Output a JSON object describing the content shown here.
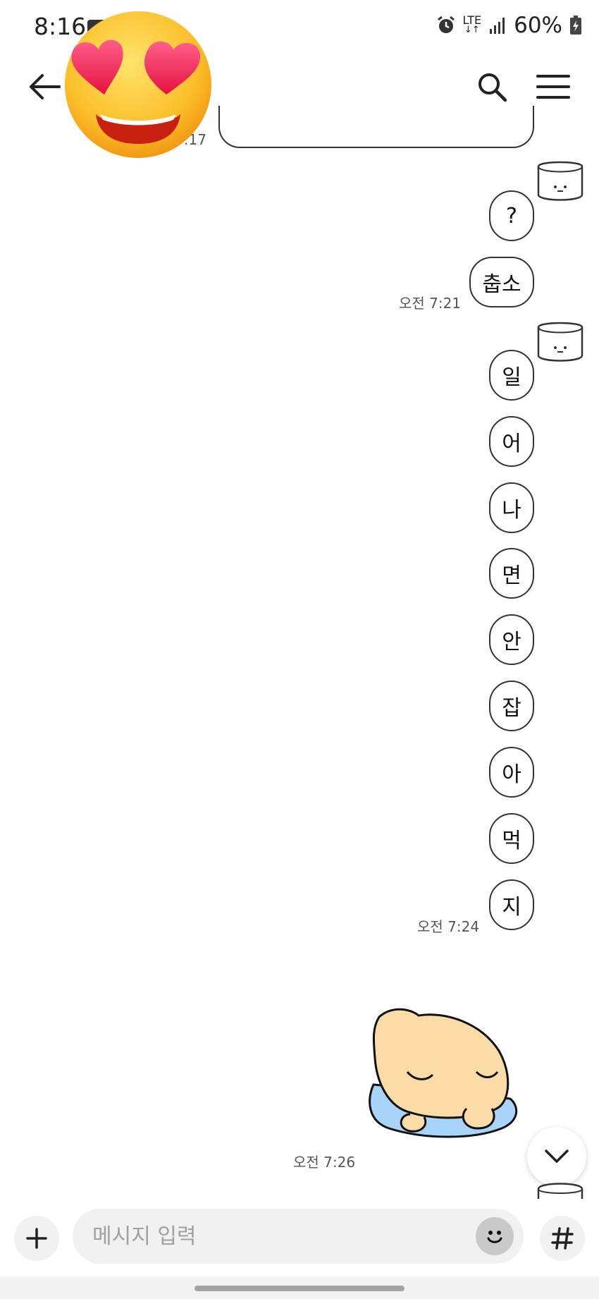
{
  "status_bar": {
    "time": "8:16",
    "network": "LTE",
    "battery": "60%"
  },
  "header": {
    "back_icon": "arrow-left-icon",
    "search_icon": "search-icon",
    "menu_icon": "hamburger-menu-icon"
  },
  "messages": {
    "top_partial_time": "7:17",
    "question": "?",
    "chulso": "춥소",
    "time_1": "오전 7:21",
    "chars": [
      "일",
      "어",
      "나",
      "면",
      "안",
      "잡",
      "아",
      "먹",
      "지"
    ],
    "time_2": "오전 7:24",
    "time_3": "오전 7:26"
  },
  "input_bar": {
    "placeholder": "메시지 입력",
    "plus_icon": "plus-icon",
    "emoji_icon": "smile-icon",
    "hash_icon": "hash-icon"
  },
  "overlay": {
    "emoji": "heart-eyes-emoji"
  },
  "scroll_button": {
    "icon": "chevron-down-icon"
  }
}
